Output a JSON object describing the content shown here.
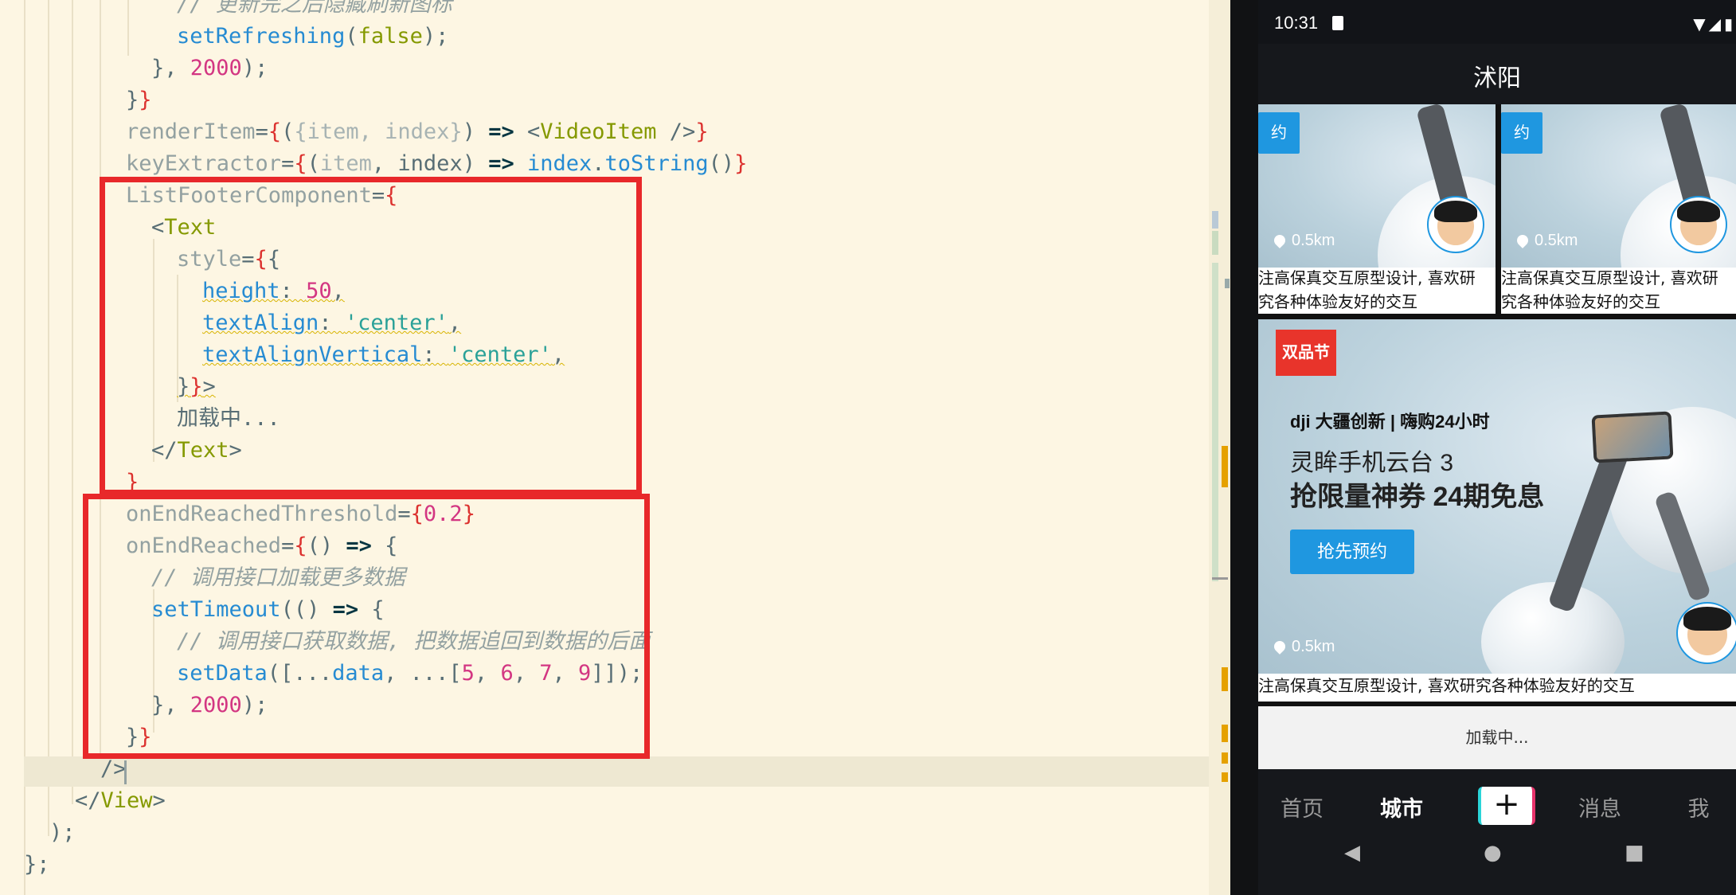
{
  "editor": {
    "lines": [
      [
        [
          "cmt",
          "// 更新完之后隐藏刷新图标"
        ]
      ],
      [
        [
          "fn",
          "setRefreshing"
        ],
        [
          "punct",
          "("
        ],
        [
          "kw2",
          "false"
        ],
        [
          "punct",
          ");"
        ]
      ],
      [
        [
          "punct",
          "}, "
        ],
        [
          "num",
          "2000"
        ],
        [
          "punct",
          ");"
        ]
      ],
      [
        [
          "punct",
          "}"
        ],
        [
          "brace",
          "}"
        ]
      ],
      [
        [
          "attr",
          "renderItem"
        ],
        [
          "punct",
          "="
        ],
        [
          "brace",
          "{"
        ],
        [
          "punct",
          "("
        ],
        [
          "dim",
          "{item, index}"
        ],
        [
          "punct",
          ") "
        ],
        [
          "kw",
          "=>"
        ],
        [
          "punct",
          " <"
        ],
        [
          "tag",
          "VideoItem"
        ],
        [
          "punct",
          " />"
        ],
        [
          "brace",
          "}"
        ]
      ],
      [
        [
          "attr",
          "keyExtractor"
        ],
        [
          "punct",
          "="
        ],
        [
          "brace",
          "{"
        ],
        [
          "punct",
          "("
        ],
        [
          "dim",
          "item"
        ],
        [
          "punct",
          ", index) "
        ],
        [
          "kw",
          "=>"
        ],
        [
          "punct",
          " "
        ],
        [
          "fn",
          "index"
        ],
        [
          "punct",
          "."
        ],
        [
          "fn",
          "toString"
        ],
        [
          "punct",
          "()"
        ],
        [
          "brace",
          "}"
        ]
      ],
      [
        [
          "attr",
          "ListFooterComponent"
        ],
        [
          "punct",
          "="
        ],
        [
          "brace",
          "{"
        ]
      ],
      [
        [
          "punct",
          "<"
        ],
        [
          "tag",
          "Text"
        ]
      ],
      [
        [
          "attr",
          "style"
        ],
        [
          "punct",
          "="
        ],
        [
          "brace",
          "{"
        ],
        [
          "punct",
          "{"
        ]
      ],
      [
        [
          "prop",
          "height"
        ],
        [
          "punct",
          ": "
        ],
        [
          "num",
          "50"
        ],
        [
          "punct",
          ","
        ]
      ],
      [
        [
          "prop",
          "textAlign"
        ],
        [
          "punct",
          ": "
        ],
        [
          "str",
          "'center'"
        ],
        [
          "punct",
          ","
        ]
      ],
      [
        [
          "prop",
          "textAlignVertical"
        ],
        [
          "punct",
          ": "
        ],
        [
          "str",
          "'center'"
        ],
        [
          "punct",
          ","
        ]
      ],
      [
        [
          "punct",
          "}"
        ],
        [
          "brace",
          "}"
        ],
        [
          "punct",
          ">"
        ]
      ],
      [
        [
          "punct",
          "加载中..."
        ]
      ],
      [
        [
          "punct",
          "</"
        ],
        [
          "tag",
          "Text"
        ],
        [
          "punct",
          ">"
        ]
      ],
      [
        [
          "brace",
          "}"
        ]
      ],
      [
        [
          "attr",
          "onEndReachedThreshold"
        ],
        [
          "punct",
          "="
        ],
        [
          "brace",
          "{"
        ],
        [
          "num",
          "0.2"
        ],
        [
          "brace",
          "}"
        ]
      ],
      [
        [
          "attr",
          "onEndReached"
        ],
        [
          "punct",
          "="
        ],
        [
          "brace",
          "{"
        ],
        [
          "punct",
          "() "
        ],
        [
          "kw",
          "=>"
        ],
        [
          "punct",
          " {"
        ]
      ],
      [
        [
          "cmt",
          "// 调用接口加载更多数据"
        ]
      ],
      [
        [
          "fn",
          "setTimeout"
        ],
        [
          "punct",
          "(() "
        ],
        [
          "kw",
          "=>"
        ],
        [
          "punct",
          " {"
        ]
      ],
      [
        [
          "cmt",
          "// 调用接口获取数据, 把数据追回到数据的后面"
        ]
      ],
      [
        [
          "fn",
          "setData"
        ],
        [
          "punct",
          "([..."
        ],
        [
          "fn",
          "data"
        ],
        [
          "punct",
          ", ...["
        ],
        [
          "num",
          "5"
        ],
        [
          "punct",
          ", "
        ],
        [
          "num",
          "6"
        ],
        [
          "punct",
          ", "
        ],
        [
          "num",
          "7"
        ],
        [
          "punct",
          ", "
        ],
        [
          "num",
          "9"
        ],
        [
          "punct",
          "]]);"
        ]
      ],
      [
        [
          "punct",
          "}, "
        ],
        [
          "num",
          "2000"
        ],
        [
          "punct",
          ");"
        ]
      ],
      [
        [
          "punct",
          "}"
        ],
        [
          "brace",
          "}"
        ]
      ],
      [
        [
          "punct",
          "/>"
        ]
      ],
      [
        [
          "punct",
          "</"
        ],
        [
          "tag",
          "View"
        ],
        [
          "punct",
          ">"
        ]
      ],
      [
        [
          "punct",
          ");"
        ]
      ],
      [
        [
          "punct",
          "};"
        ]
      ]
    ]
  },
  "phone": {
    "status": {
      "time": "10:31",
      "icons": "▼◢▮"
    },
    "title": "沭阳",
    "cards": {
      "small_badge": "约",
      "distance": "0.5km",
      "desc_line1": "注高保真交互原型设计, 喜欢研",
      "desc_line2": "究各种体验友好的交互",
      "desc_line1_b": "注高保真交互原型设计, 喜欢研",
      "desc_line2_b": "究各种体验友好的交互"
    },
    "ad": {
      "tag": "双品节",
      "brand": "dji 大疆创新 | 嗨购24小时",
      "brand_sub": "",
      "line1": "灵眸手机云台 3",
      "line2": "抢限量神券 24期免息",
      "button": "抢先预约",
      "distance": "0.5km",
      "desc": "注高保真交互原型设计, 喜欢研究各种体验友好的交互"
    },
    "footer_loading": "加载中...",
    "tabs": [
      {
        "label": "首页",
        "active": false
      },
      {
        "label": "城市",
        "active": true
      },
      {
        "label": "+",
        "active": false
      },
      {
        "label": "消息",
        "active": false
      },
      {
        "label": "我",
        "active": false
      }
    ],
    "nav": {
      "back": "◀",
      "home": "●",
      "recent": "■"
    }
  }
}
